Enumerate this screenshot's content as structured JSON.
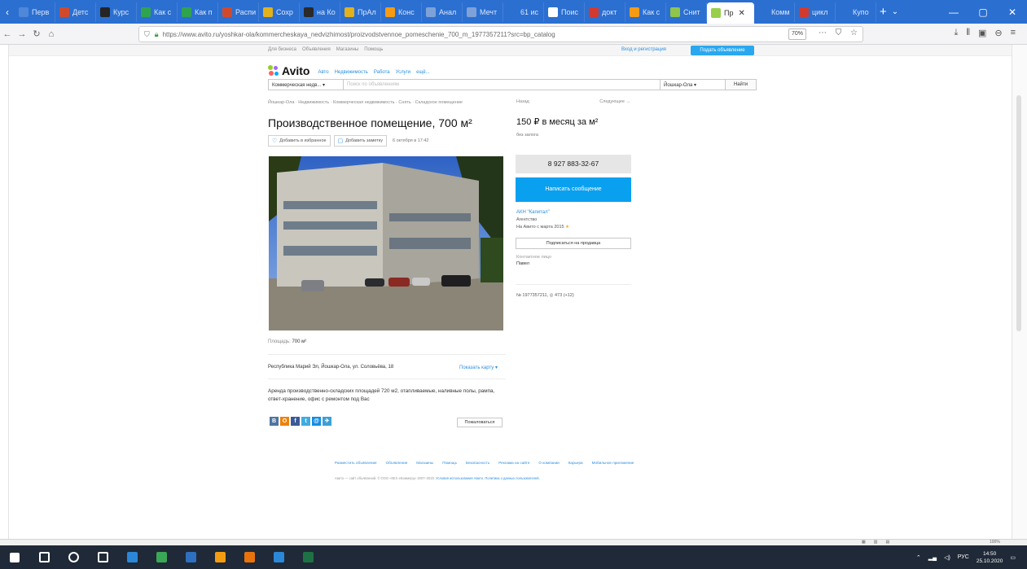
{
  "browser": {
    "tabs": [
      {
        "label": "Перв",
        "color": "#4f87d9"
      },
      {
        "label": "Детс",
        "color": "#cf4a2d"
      },
      {
        "label": "Курс",
        "color": "#252525"
      },
      {
        "label": "Как с",
        "color": "#2fa44f"
      },
      {
        "label": "Как п",
        "color": "#2fa44f"
      },
      {
        "label": "Распи",
        "color": "#cf4a2d"
      },
      {
        "label": "Сохр",
        "color": "#e2b11c"
      },
      {
        "label": "на Ко",
        "color": "#2a2a2a"
      },
      {
        "label": "ПрАл",
        "color": "#e2b11c"
      },
      {
        "label": "Конс",
        "color": "#f59b14"
      },
      {
        "label": "Анал",
        "color": "#7ea2d8"
      },
      {
        "label": "Мечт",
        "color": "#7ea2d8"
      },
      {
        "label": "61 ис",
        "color": "#2b6fd1"
      },
      {
        "label": "Поис",
        "color": "#ffffff"
      },
      {
        "label": "докт",
        "color": "#d33a2f"
      },
      {
        "label": "Как с",
        "color": "#f59b14"
      },
      {
        "label": "Снит",
        "color": "#8fc54a"
      },
      {
        "label": "Пр",
        "color": "#97cf4a",
        "active": true
      },
      {
        "label": "Комм",
        "color": "#2b6fd1"
      },
      {
        "label": "цикл",
        "color": "#d33a2f"
      },
      {
        "label": "Купо",
        "color": "#2b6fd1"
      }
    ],
    "tab_close": "✕",
    "new_tab": "+",
    "url": "https://www.avito.ru/yoshkar-ola/kommercheskaya_nedvizhimost/proizvodstvennoe_pomeschenie_700_m_1977357211?src=bp_catalog",
    "zoom": "70%"
  },
  "avito": {
    "topnav": [
      "Для бизнеса",
      "Объявления",
      "Магазины",
      "Помощь"
    ],
    "login": "Вход и регистрация",
    "post_ad": "Подать объявление",
    "logo": "Avito",
    "categories": [
      "Авто",
      "Недвижимость",
      "Работа",
      "Услуги",
      "ещё..."
    ],
    "search": {
      "category": "Коммерческая недв...",
      "placeholder": "Поиск по объявлениям",
      "city": "Йошкар-Ола",
      "button": "Найти"
    },
    "breadcrumbs": "Йошкар-Ола · Недвижимость · Коммерческая недвижимость · Снять · Складское помещение",
    "back": "Назад",
    "next": "Следующее →",
    "title": "Производственное помещение, 700 м²",
    "price": "150 ₽ в месяц за м²",
    "price_note": "без залога",
    "favorite": "Добавить в избранное",
    "note": "Добавить заметку",
    "date": "6 октября в 17:42",
    "phone": "8 927 883-32-67",
    "message": "Написать сообщение",
    "seller_name": "АКН \"Капитал\"",
    "seller_type": "Агентство",
    "seller_since": "На Авито с марта 2015",
    "subscribe": "Подписаться на продавца",
    "contact_label": "Контактное лицо",
    "contact_name": "Павел",
    "ad_meta": "№ 1977357211, ◎ 473 (+12)",
    "area_label": "Площадь:",
    "area_value": "700 м²",
    "address": "Республика Марий Эл, Йошкар-Ола, ул. Соловьёва, 18",
    "show_map": "Показать карту ▾",
    "description": "Аренда производственно-складских площадей 720 м2, отапливаемые, наливные полы, рампа, ответ-хранение, офис с ремонтом под Вас",
    "share": [
      {
        "label": "В",
        "color": "#4d76a1"
      },
      {
        "label": "О",
        "color": "#ee8208"
      },
      {
        "label": "f",
        "color": "#3b5998"
      },
      {
        "label": "t",
        "color": "#41abe1"
      },
      {
        "label": "@",
        "color": "#168de2"
      },
      {
        "label": "✈",
        "color": "#3aa1d6"
      }
    ],
    "complain": "Пожаловаться",
    "footer_links": [
      "Разместить объявление",
      "Объявления",
      "Магазины",
      "Помощь",
      "Безопасность",
      "Реклама на сайте",
      "О компании",
      "Карьера",
      "Мобильное приложение"
    ],
    "footer_legal": "Авито — сайт объявлений. © ООО «КЕХ еКоммерц» 2007–2020.",
    "footer_legal_link": "Условия использования Авито. Политика о данных пользователей."
  },
  "statusbar": {
    "zoom": "100%"
  },
  "taskbar": {
    "apps": [
      {
        "name": "start",
        "color": "#ffffff"
      },
      {
        "name": "search",
        "color": "#ffffff"
      },
      {
        "name": "cortana",
        "color": "#ffffff"
      },
      {
        "name": "taskview",
        "color": "#ffffff"
      },
      {
        "name": "app1",
        "color": "#2b88d8"
      },
      {
        "name": "app2",
        "color": "#3aa757"
      },
      {
        "name": "app3",
        "color": "#2f6fbf"
      },
      {
        "name": "app4",
        "color": "#f39c12"
      },
      {
        "name": "firefox",
        "color": "#e8730c"
      },
      {
        "name": "app5",
        "color": "#2b88d8"
      },
      {
        "name": "excel",
        "color": "#1e7145"
      }
    ],
    "lang": "РУС",
    "time": "14:50",
    "date": "25.10.2020"
  }
}
